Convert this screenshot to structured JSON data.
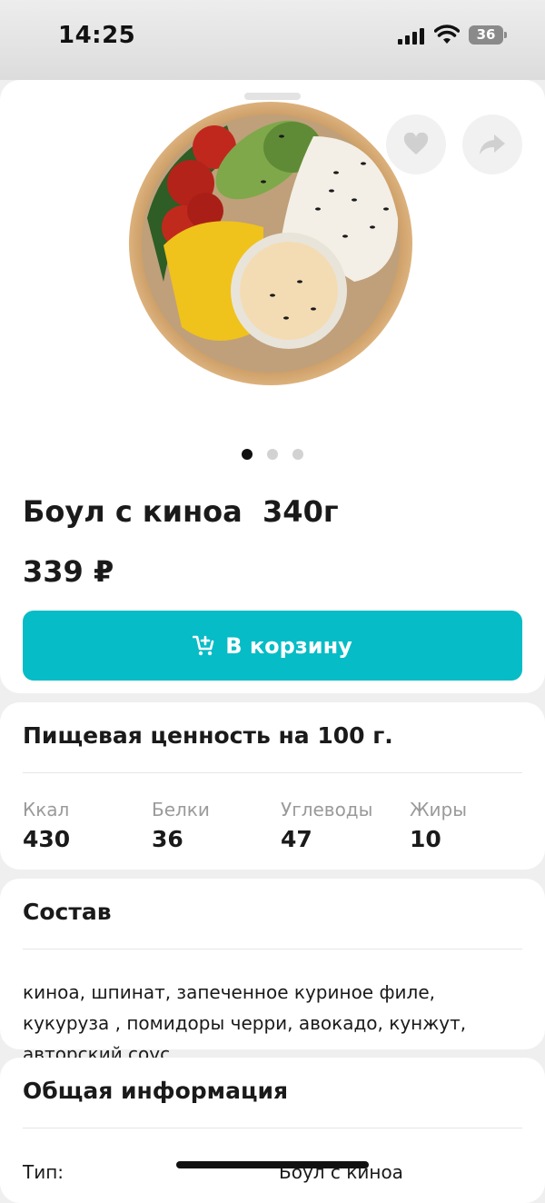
{
  "status": {
    "time": "14:25",
    "battery": "36"
  },
  "product": {
    "title": "Боул с киноа  340г",
    "price": "339 ₽",
    "carousel_pages": 3,
    "carousel_active": 1,
    "add_to_cart": "В корзину"
  },
  "nutrition": {
    "title": "Пищевая ценность на 100 г.",
    "items": [
      {
        "label": "Ккал",
        "value": "430"
      },
      {
        "label": "Белки",
        "value": "36"
      },
      {
        "label": "Углеводы",
        "value": "47"
      },
      {
        "label": "Жиры",
        "value": "10"
      }
    ]
  },
  "composition": {
    "title": "Состав",
    "text": "киноа, шпинат, запеченное куриное филе, кукуруза , помидоры черри, авокадо, кунжут, авторский соус"
  },
  "general": {
    "title": "Общая информация",
    "rows": [
      {
        "key": "Тип:",
        "value": "Боул с киноа"
      }
    ]
  },
  "icons": {
    "favorite": "heart-icon",
    "share": "share-icon",
    "cart": "cart-add-icon"
  },
  "colors": {
    "accent": "#06bcc6"
  }
}
